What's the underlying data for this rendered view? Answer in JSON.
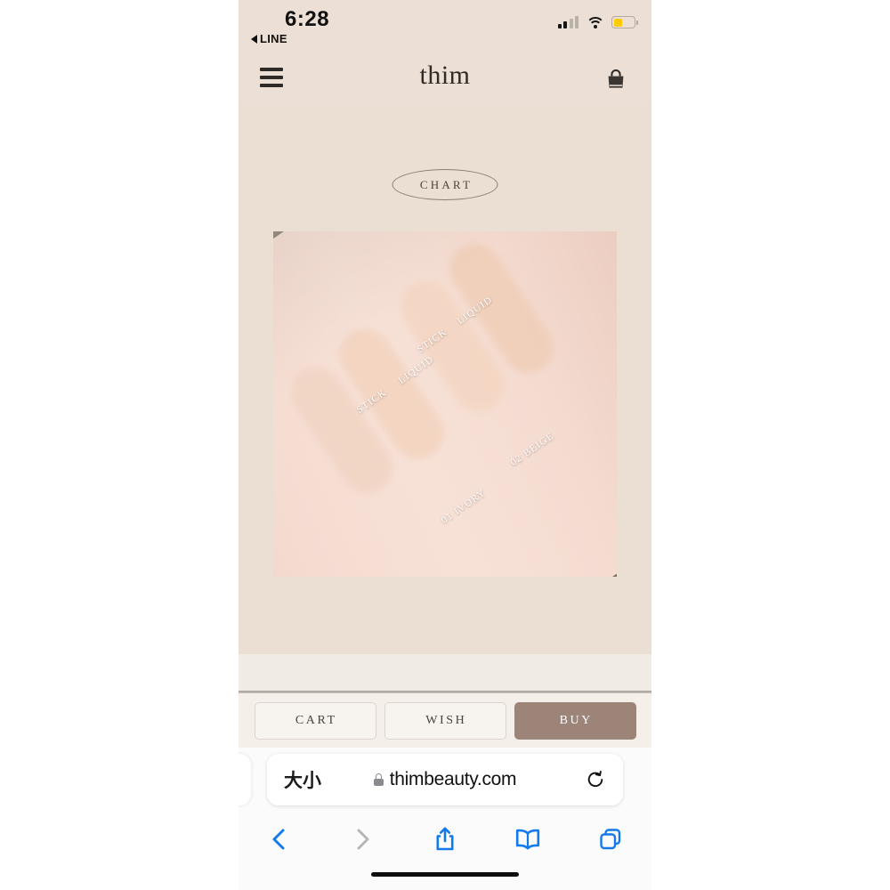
{
  "status_bar": {
    "time": "6:28",
    "back_app": "LINE",
    "back_icon": "triangle-left-icon",
    "signal_icon": "cellular-signal-icon",
    "signal_bars_filled": 2,
    "signal_bars_total": 4,
    "wifi_icon": "wifi-icon",
    "battery_icon": "battery-low-power-icon",
    "battery_fill_color": "#ffcc00"
  },
  "site_header": {
    "menu_icon": "hamburger-menu-icon",
    "brand": "thim",
    "cart_icon": "shopping-bag-icon"
  },
  "product": {
    "chart_badge": "CHART",
    "photo": {
      "name": "foundation-swatch-photo",
      "labels": [
        {
          "text": "STICK",
          "key": "stick_1"
        },
        {
          "text": "LIQUID",
          "key": "liquid_1"
        },
        {
          "text": "STICK",
          "key": "stick_2"
        },
        {
          "text": "LIQUID",
          "key": "liquid_2"
        },
        {
          "text": "01 IVORY",
          "key": "ivory"
        },
        {
          "text": "02 BEIGE",
          "key": "beige"
        }
      ]
    }
  },
  "action_bar": {
    "buttons": [
      {
        "label": "CART",
        "style": "outline"
      },
      {
        "label": "WISH",
        "style": "outline"
      },
      {
        "label": "BUY",
        "style": "filled"
      }
    ],
    "filled_color": "#9c8478"
  },
  "browser": {
    "text_size_button": "大小",
    "lock_icon": "lock-icon",
    "url": "thimbeauty.com",
    "reload_icon": "reload-icon",
    "toolbar": [
      {
        "icon": "back-chevron-icon",
        "state": "enabled"
      },
      {
        "icon": "forward-chevron-icon",
        "state": "disabled"
      },
      {
        "icon": "share-icon",
        "state": "enabled"
      },
      {
        "icon": "bookmarks-icon",
        "state": "enabled"
      },
      {
        "icon": "tabs-icon",
        "state": "enabled"
      }
    ],
    "accent_color": "#137aec",
    "disabled_color": "#b6b6b6"
  },
  "colors": {
    "page_background": "#ebdfd4",
    "header_background": "#ecdfd5",
    "photo_backdrop": "#8d8278",
    "skin": "#f4dbd0"
  }
}
